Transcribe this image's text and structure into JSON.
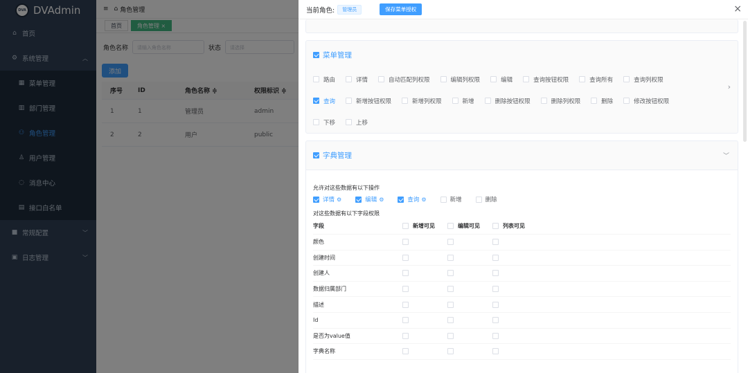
{
  "app": {
    "logo_text": "DVAdmin",
    "logo_mark": "DVA"
  },
  "sidebar": {
    "items": [
      {
        "label": "首页",
        "icon": "home-icon"
      },
      {
        "label": "系统管理",
        "icon": "gear-icon"
      },
      {
        "label": "菜单管理",
        "icon": "grid-icon"
      },
      {
        "label": "部门管理",
        "icon": "building-icon"
      },
      {
        "label": "角色管理",
        "icon": "role-icon"
      },
      {
        "label": "用户管理",
        "icon": "user-icon"
      },
      {
        "label": "消息中心",
        "icon": "message-icon"
      },
      {
        "label": "接口白名单",
        "icon": "whitelist-icon"
      },
      {
        "label": "常规配置",
        "icon": "config-icon"
      },
      {
        "label": "日志管理",
        "icon": "log-icon"
      }
    ]
  },
  "header": {
    "breadcrumb": "角色管理"
  },
  "tags": [
    "首页",
    "角色管理 ×"
  ],
  "filter": {
    "role_name_label": "角色名称",
    "role_name_placeholder": "请输入角色名称",
    "status_label": "状态",
    "status_placeholder": "请选择"
  },
  "add_button": "添加",
  "table": {
    "columns": [
      "序号",
      "ID",
      "角色名称 ≑",
      "权限标识 ≑"
    ],
    "rows": [
      [
        "1",
        "1",
        "管理员",
        "admin"
      ],
      [
        "2",
        "2",
        "用户",
        "public"
      ]
    ]
  },
  "drawer": {
    "title_label": "当前角色:",
    "role_badge": "管理员",
    "save_button": "保存菜单授权",
    "close": "×"
  },
  "menu_mgmt": {
    "title": "菜单管理",
    "checked": true,
    "rows": [
      [
        {
          "l": "路由",
          "c": false
        },
        {
          "l": "详情",
          "c": false
        },
        {
          "l": "自动匹配列权限",
          "c": false
        },
        {
          "l": "编辑列权限",
          "c": false
        },
        {
          "l": "编辑",
          "c": false
        },
        {
          "l": "查询按钮权限",
          "c": false
        },
        {
          "l": "查询所有",
          "c": false
        },
        {
          "l": "查询列权限",
          "c": false
        }
      ],
      [
        {
          "l": "查询",
          "c": true
        },
        {
          "l": "新增按钮权限",
          "c": false
        },
        {
          "l": "新增列权限",
          "c": false
        },
        {
          "l": "新增",
          "c": false
        },
        {
          "l": "删除按钮权限",
          "c": false
        },
        {
          "l": "删除列权限",
          "c": false
        },
        {
          "l": "删除",
          "c": false
        },
        {
          "l": "修改按钮权限",
          "c": false
        }
      ],
      [
        {
          "l": "下移",
          "c": false
        },
        {
          "l": "上移",
          "c": false
        }
      ]
    ]
  },
  "dict_mgmt": {
    "title": "字典管理",
    "checked": true,
    "ops_label": "允许对这些数据有以下操作",
    "ops": [
      {
        "l": "详情",
        "c": true
      },
      {
        "l": "编辑",
        "c": true
      },
      {
        "l": "查询",
        "c": true
      },
      {
        "l": "新增",
        "c": false
      },
      {
        "l": "删除",
        "c": false
      }
    ],
    "fields_label": "对这些数据有以下字段权限",
    "field_header": "字段",
    "col_create": "新增可见",
    "col_edit": "编辑可见",
    "col_list": "列表可见",
    "fields": [
      "颜色",
      "创建时间",
      "创建人",
      "数据归属部门",
      "描述",
      "Id",
      "是否为value值",
      "字典名称"
    ]
  }
}
